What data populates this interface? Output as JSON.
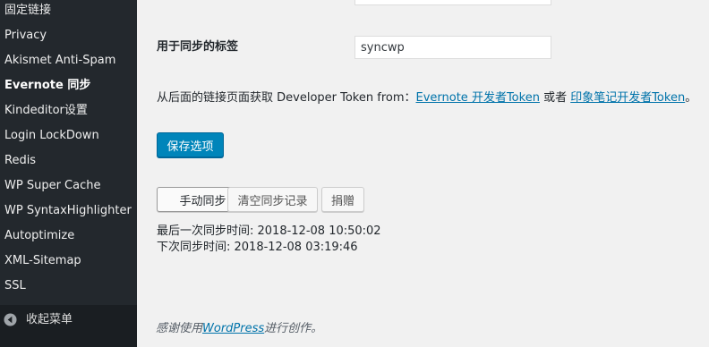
{
  "sidebar": {
    "items": [
      {
        "label": "固定链接"
      },
      {
        "label": "Privacy"
      },
      {
        "label": "Akismet Anti-Spam"
      },
      {
        "label": "Evernote 同步",
        "current": true
      },
      {
        "label": "Kindeditor设置"
      },
      {
        "label": "Login LockDown"
      },
      {
        "label": "Redis"
      },
      {
        "label": "WP Super Cache"
      },
      {
        "label": "WP SyntaxHighlighter"
      },
      {
        "label": "Autoptimize"
      },
      {
        "label": "XML-Sitemap"
      },
      {
        "label": "SSL"
      }
    ],
    "collapse_label": "收起菜单"
  },
  "form": {
    "tag_label": "用于同步的标签",
    "tag_value": "syncwp",
    "token_prefix": "从后面的链接页面获取 Developer Token from：",
    "token_link_evernote": "Evernote 开发者Token",
    "token_or": " 或者 ",
    "token_link_yinxiang": "印象笔记开发者Token",
    "token_suffix": "。",
    "save_label": "保存选项"
  },
  "actions": {
    "sync_label": "手动同步",
    "clear_label": "清空同步记录",
    "donate_label": "捐赠"
  },
  "status": {
    "last_sync": "最后一次同步时间: 2018-12-08 10:50:02",
    "next_sync": "下次同步时间: 2018-12-08 03:19:46"
  },
  "footer": {
    "prefix": "感谢使用",
    "link": "WordPress",
    "suffix": "进行创作。"
  },
  "colors": {
    "sidebar_bg": "#23282d",
    "primary_button": "#0085ba",
    "link": "#0073aa"
  }
}
